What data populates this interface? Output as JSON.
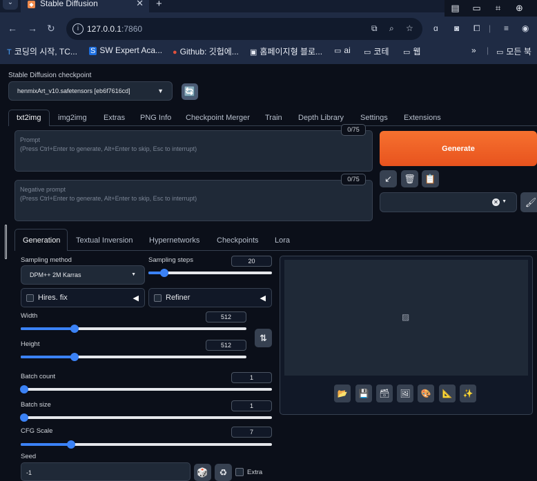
{
  "browser": {
    "tab_title": "Stable Diffusion",
    "tab_favicon": "stable-diffusion-icon",
    "new_tab_label": "+",
    "url_host": "127.0.0.1",
    "url_port": ":7860",
    "bookmarks": [
      {
        "label": "코딩의 시작, TC...",
        "icon": "T"
      },
      {
        "label": "SW Expert Aca...",
        "icon": "S"
      },
      {
        "label": "Github: 깃헙에...",
        "icon": "●"
      },
      {
        "label": "홈페이지형 블로...",
        "icon": "▣"
      },
      {
        "label": "ai",
        "icon": "folder"
      },
      {
        "label": "코테",
        "icon": "folder"
      },
      {
        "label": "웹",
        "icon": "folder"
      },
      {
        "label": "모든 북",
        "icon": "folder"
      }
    ],
    "overflow_label": "»"
  },
  "checkpoint": {
    "label": "Stable Diffusion checkpoint",
    "value": "henmixArt_v10.safetensors [eb6f7616cd]"
  },
  "main_tabs": [
    "txt2img",
    "img2img",
    "Extras",
    "PNG Info",
    "Checkpoint Merger",
    "Train",
    "Depth Library",
    "Settings",
    "Extensions"
  ],
  "prompt": {
    "label": "Prompt",
    "placeholder": "(Press Ctrl+Enter to generate, Alt+Enter to skip, Esc to interrupt)",
    "counter": "0/75"
  },
  "negative_prompt": {
    "label": "Negative prompt",
    "placeholder": "(Press Ctrl+Enter to generate, Alt+Enter to skip, Esc to interrupt)",
    "counter": "0/75"
  },
  "generate_label": "Generate",
  "sub_tabs": [
    "Generation",
    "Textual Inversion",
    "Hypernetworks",
    "Checkpoints",
    "Lora"
  ],
  "generation": {
    "sampling_method": {
      "label": "Sampling method",
      "value": "DPM++ 2M Karras"
    },
    "sampling_steps": {
      "label": "Sampling steps",
      "value": "20",
      "fraction": 0.13
    },
    "hires_fix": "Hires. fix",
    "refiner": "Refiner",
    "width": {
      "label": "Width",
      "value": "512",
      "fraction": 0.24
    },
    "height": {
      "label": "Height",
      "value": "512",
      "fraction": 0.24
    },
    "batch_count": {
      "label": "Batch count",
      "value": "1",
      "fraction": 0.0
    },
    "batch_size": {
      "label": "Batch size",
      "value": "1",
      "fraction": 0.0
    },
    "cfg_scale": {
      "label": "CFG Scale",
      "value": "7",
      "fraction": 0.2
    },
    "seed": {
      "label": "Seed",
      "value": "-1"
    },
    "extra_label": "Extra"
  },
  "colors": {
    "accent": "#3b82f6",
    "generate": "#f26a2b",
    "background": "#0b0f19"
  }
}
